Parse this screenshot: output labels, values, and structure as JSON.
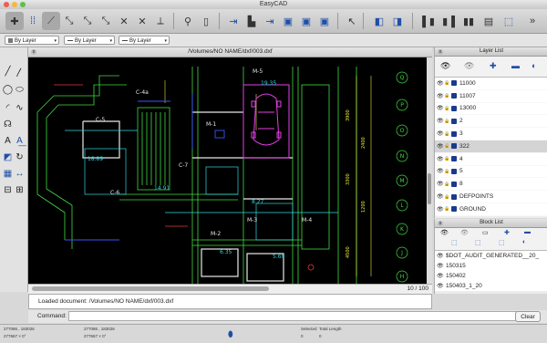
{
  "window": {
    "title": "EasyCAD"
  },
  "toolbar": {
    "icons": [
      "select-tool-icon",
      "grid-snap-icon",
      "snap-endpoint-icon",
      "snap-midpoint-icon",
      "snap-center-icon",
      "snap-intersection-icon",
      "snap-perpendicular-icon",
      "snap-nearest-icon",
      "snap-tangent-icon",
      "pick-point-icon",
      "new-file-icon",
      "open-file-icon",
      "save-icon",
      "save-as-icon",
      "print-icon",
      "export-icon",
      "import-icon",
      "cursor-icon",
      "layout-left-icon",
      "layout-right-icon",
      "panel-left-icon",
      "panel-right-icon",
      "panel-both-icon",
      "properties-icon"
    ]
  },
  "props": {
    "color": "By Layer",
    "linetype": "By Layer",
    "lineweight": "By Layer"
  },
  "document": {
    "title": "/Volumes/NO NAME/dxf/003.dxf",
    "page": "10 / 100",
    "close": "x"
  },
  "cad_labels": [
    "19.35",
    "18.89",
    "14.91",
    "6.35",
    "5.69",
    "8.27",
    "C-5",
    "M-5",
    "M-1",
    "M-2",
    "M-3",
    "M-4",
    "C-4a",
    "C-6",
    "C-7",
    "3900",
    "3300",
    "2400",
    "1200",
    "4500"
  ],
  "axes": [
    "Q",
    "P",
    "O",
    "N",
    "M",
    "L",
    "K",
    "J",
    "H"
  ],
  "layers": {
    "title": "Layer List",
    "close": "x",
    "items": [
      {
        "name": "11000",
        "selected": false
      },
      {
        "name": "11007",
        "selected": false
      },
      {
        "name": "13000",
        "selected": false
      },
      {
        "name": "2",
        "selected": false
      },
      {
        "name": "3",
        "selected": false
      },
      {
        "name": "322",
        "selected": true
      },
      {
        "name": "4",
        "selected": false
      },
      {
        "name": "5",
        "selected": false
      },
      {
        "name": "8",
        "selected": false
      },
      {
        "name": "DEFPOINTS",
        "selected": false
      },
      {
        "name": "GROUND",
        "selected": false
      }
    ]
  },
  "blocks": {
    "title": "Block List",
    "close": "x",
    "items": [
      {
        "name": "$DOT_AUDIT_GENERATED__20_"
      },
      {
        "name": "150315"
      },
      {
        "name": "150402"
      },
      {
        "name": "150403_1_20"
      }
    ]
  },
  "message": "Loaded document: /Volumes/NO NAME/dxf/003.dxf",
  "command": {
    "label": "Command:",
    "value": ""
  },
  "clear_button": "Clear",
  "status": {
    "coord_a1": "277086 , 183026",
    "coord_a2": "277667 × 0°",
    "coord_b1": "277086 , 183026",
    "coord_b2": "277667 × 0°",
    "selected_label": "Selected",
    "selected_value": "0",
    "total_length_label": "Total Length",
    "total_length_value": "0"
  },
  "colors": {
    "cad_background": "#000000",
    "line_green": "#3fdc3f",
    "line_cyan": "#2fd8e0",
    "line_yellow": "#e8e83a",
    "line_magenta": "#e53fe5",
    "line_white": "#e8e8e8",
    "line_blue": "#3a55ff",
    "line_red": "#e23a3a",
    "layer_swatch": "#1b3a8c"
  }
}
